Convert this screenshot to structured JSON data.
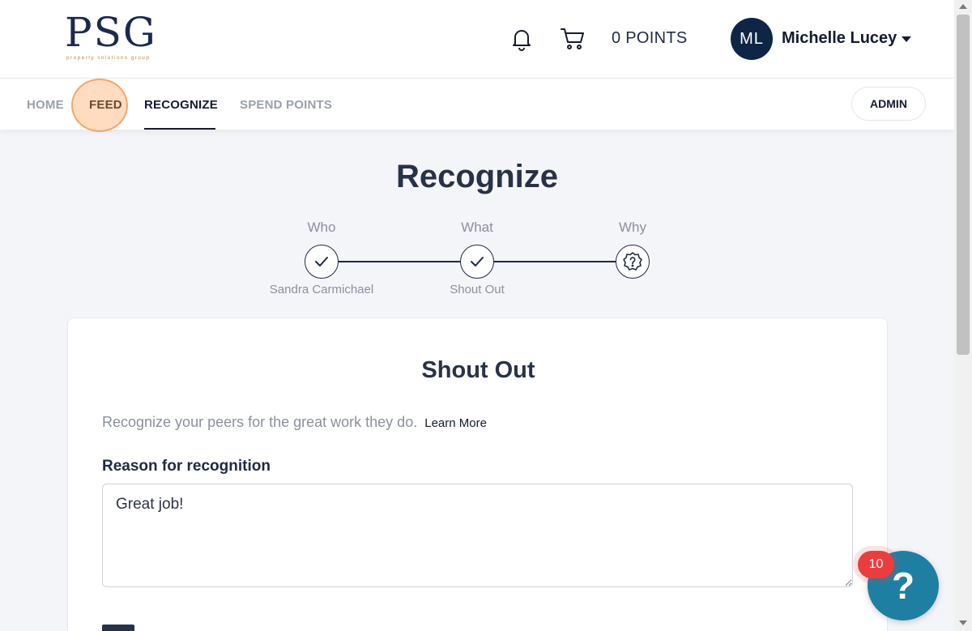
{
  "header": {
    "logo_text": "PSG",
    "logo_subtitle": "property solutions group",
    "points_label": "0 POINTS",
    "avatar_initials": "ML",
    "user_name": "Michelle Lucey"
  },
  "nav": {
    "home": "HOME",
    "feed": "FEED",
    "recognize": "RECOGNIZE",
    "spend_points": "SPEND POINTS",
    "admin": "ADMIN"
  },
  "page": {
    "title": "Recognize"
  },
  "steps": [
    {
      "label": "Who",
      "value": "Sandra Carmichael",
      "state": "done"
    },
    {
      "label": "What",
      "value": "Shout Out",
      "state": "done"
    },
    {
      "label": "Why",
      "value": "",
      "state": "current"
    }
  ],
  "card": {
    "title": "Shout Out",
    "description": "Recognize your peers for the great work they do.",
    "learn_more": "Learn More",
    "reason_label": "Reason for recognition",
    "reason_value": "Great job!"
  },
  "help": {
    "icon_glyph": "?",
    "badge_count": "10"
  },
  "colors": {
    "brand_navy": "#0f2546",
    "help_blue": "#1f7fa3",
    "badge_red": "#ea3e3e",
    "highlight_orange": "#f5a66b"
  }
}
